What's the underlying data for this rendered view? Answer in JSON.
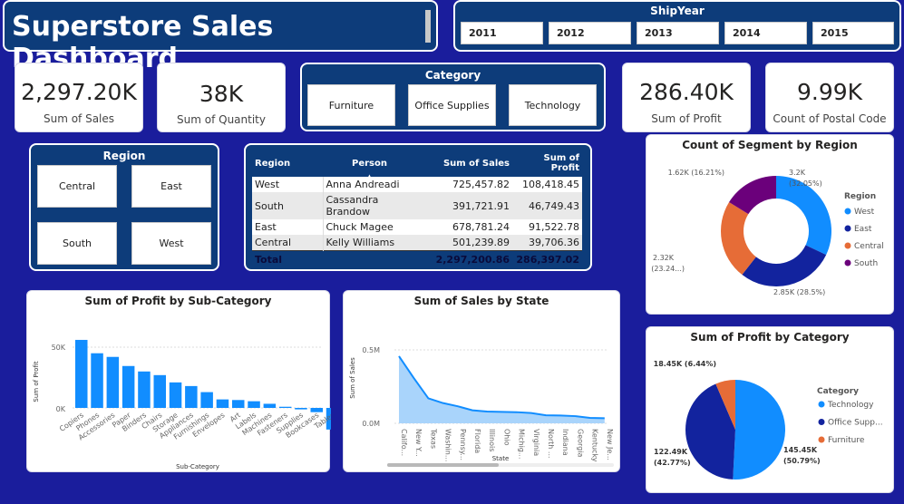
{
  "header": {
    "title": "Superstore Sales Dashboard"
  },
  "shipyear": {
    "title": "ShipYear",
    "options": [
      "2011",
      "2012",
      "2013",
      "2014",
      "2015"
    ]
  },
  "kpis": {
    "sales": {
      "value": "2,297.20K",
      "label": "Sum of Sales"
    },
    "quantity": {
      "value": "38K",
      "label": "Sum of Quantity"
    },
    "profit": {
      "value": "286.40K",
      "label": "Sum of Profit"
    },
    "postal": {
      "value": "9.99K",
      "label": "Count of Postal Code"
    }
  },
  "category_slicer": {
    "title": "Category",
    "options": [
      "Furniture",
      "Office Supplies",
      "Technology"
    ]
  },
  "region_slicer": {
    "title": "Region",
    "options": [
      "Central",
      "East",
      "South",
      "West"
    ]
  },
  "table": {
    "columns": [
      "Region",
      "Person",
      "Sum of Sales",
      "Sum of Profit"
    ],
    "rows": [
      [
        "West",
        "Anna Andreadi",
        "725,457.82",
        "108,418.45"
      ],
      [
        "South",
        "Cassandra Brandow",
        "391,721.91",
        "46,749.43"
      ],
      [
        "East",
        "Chuck Magee",
        "678,781.24",
        "91,522.78"
      ],
      [
        "Central",
        "Kelly Williams",
        "501,239.89",
        "39,706.36"
      ]
    ],
    "total": [
      "Total",
      "",
      "2,297,200.86",
      "286,397.02"
    ]
  },
  "donut": {
    "title": "Count of Segment by Region",
    "legend_title": "Region",
    "labels": [
      "3.2K",
      "(32.05%)",
      "2.85K (28.5%)",
      "2.32K",
      "(23.24...)",
      "1.62K (16.21%)"
    ]
  },
  "pie": {
    "title": "Sum of Profit by Category",
    "legend_title": "Category",
    "labels": [
      "18.45K (6.44%)",
      "122.49K",
      "(42.77%)",
      "145.45K",
      "(50.79%)"
    ]
  },
  "colors": {
    "background": "#1a1d9c",
    "navy": "#0d3c7a",
    "bar_blue": "#118dff",
    "dark_blue": "#12239e",
    "orange": "#e66c37",
    "purple": "#6b007b"
  },
  "chart_data": [
    {
      "type": "pie",
      "title": "Count of Segment by Region",
      "categories": [
        "West",
        "East",
        "Central",
        "South"
      ],
      "values": [
        3200,
        2850,
        2320,
        1620
      ],
      "percent": [
        32.05,
        28.5,
        23.24,
        16.21
      ],
      "colors": [
        "#118dff",
        "#12239e",
        "#e66c37",
        "#6b007b"
      ],
      "legend": "right"
    },
    {
      "type": "pie",
      "title": "Sum of Profit by Category",
      "categories": [
        "Technology",
        "Office Supp...",
        "Furniture"
      ],
      "values": [
        145450,
        122490,
        18450
      ],
      "percent": [
        50.79,
        42.77,
        6.44
      ],
      "colors": [
        "#118dff",
        "#12239e",
        "#e66c37"
      ],
      "legend": "right"
    },
    {
      "type": "bar",
      "title": "Sum of Profit by Sub-Category",
      "xlabel": "Sub-Category",
      "ylabel": "Sum of Profit",
      "categories": [
        "Copiers",
        "Phones",
        "Accessories",
        "Paper",
        "Binders",
        "Chairs",
        "Storage",
        "Appliances",
        "Furnishings",
        "Envelopes",
        "Art",
        "Labels",
        "Machines",
        "Fasteners",
        "Supplies",
        "Bookcases",
        "Tables"
      ],
      "values": [
        56000,
        45000,
        42000,
        34500,
        30000,
        27000,
        21000,
        18000,
        13000,
        7000,
        6500,
        5500,
        3400,
        950,
        -1200,
        -3500,
        -17800
      ],
      "yticks": [
        "50K",
        "0K"
      ],
      "ylim": [
        -20000,
        60000
      ]
    },
    {
      "type": "area",
      "title": "Sum of Sales by State",
      "xlabel": "State",
      "ylabel": "Sum of Sales",
      "categories": [
        "Califo...",
        "New Y...",
        "Texas",
        "Washin...",
        "Pennsy...",
        "Florida",
        "Illinois",
        "Ohio",
        "Michig...",
        "Virginia",
        "North ...",
        "Indiana",
        "Georgia",
        "Kentucky",
        "New Je..."
      ],
      "values": [
        457000,
        310000,
        170000,
        138000,
        116000,
        89000,
        80000,
        78000,
        76000,
        70000,
        55000,
        53000,
        49000,
        37000,
        35000
      ],
      "yticks": [
        "0.5M",
        "0.0M"
      ],
      "ylim": [
        0,
        500000
      ]
    }
  ]
}
